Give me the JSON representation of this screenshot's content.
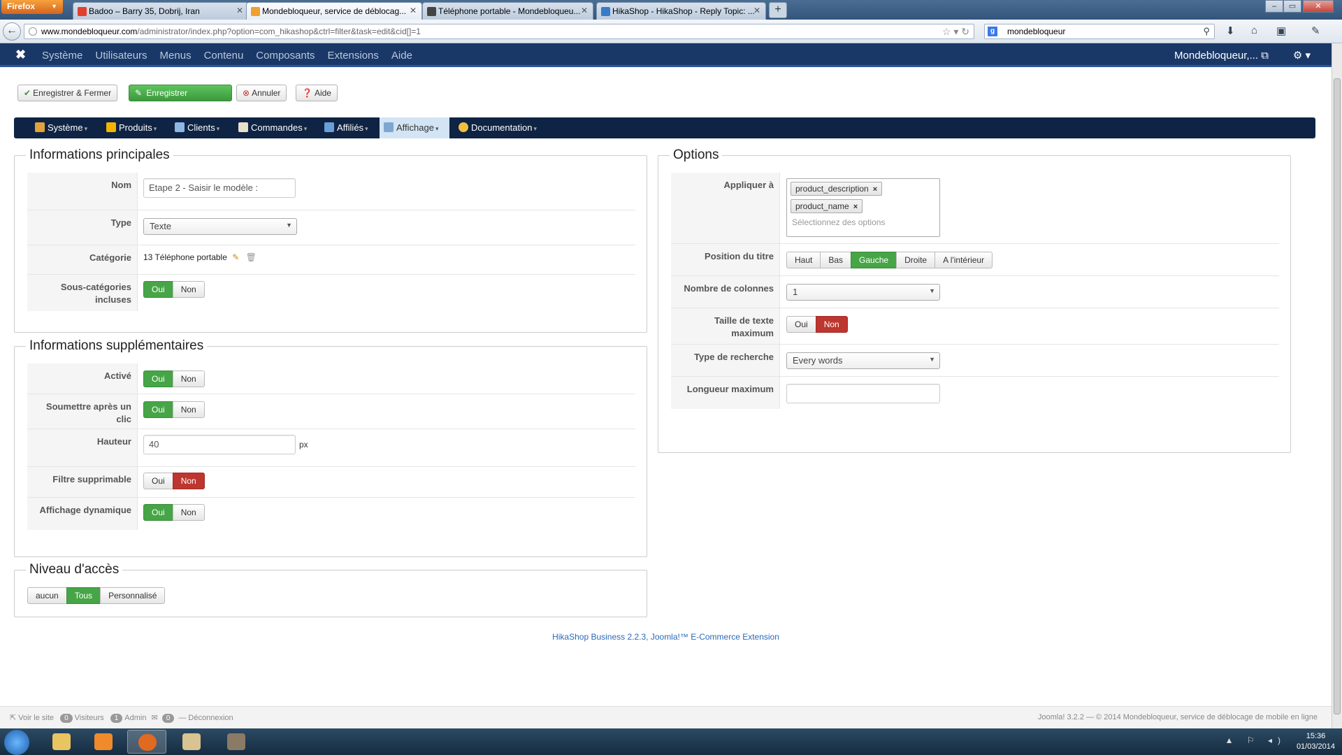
{
  "browser": {
    "app_button": "Firefox",
    "tabs": [
      {
        "title": "Badoo – Barry 35, Dobrij, Iran",
        "favicon_color": "#e0402c"
      },
      {
        "title": "Mondebloqueur, service de déblocag...",
        "favicon_color": "#f0a030"
      },
      {
        "title": "Téléphone portable - Mondebloqueu...",
        "favicon_color": "#444444"
      },
      {
        "title": "HikaShop - HikaShop - Reply Topic: ...",
        "favicon_color": "#3a7bc8"
      }
    ],
    "new_tab": "+",
    "url_host": "www.mondebloqueur.com",
    "url_path": "/administrator/index.php?option=com_hikashop&ctrl=filter&task=edit&cid[]=1",
    "search_value": "mondebloqueur"
  },
  "joomla": {
    "menu": [
      "Système",
      "Utilisateurs",
      "Menus",
      "Contenu",
      "Composants",
      "Extensions",
      "Aide"
    ],
    "user": "Mondebloqueur,..."
  },
  "toolbar": {
    "save_close": "Enregistrer & Fermer",
    "save": "Enregistrer",
    "cancel": "Annuler",
    "help": "Aide"
  },
  "hika_menu": {
    "items": [
      "Système",
      "Produits",
      "Clients",
      "Commandes",
      "Affiliés",
      "Affichage",
      "Documentation"
    ],
    "active": "Affichage"
  },
  "main_info": {
    "legend": "Informations principales",
    "name_label": "Nom",
    "name_value": "Etape 2 - Saisir le modèle :",
    "type_label": "Type",
    "type_value": "Texte",
    "category_label": "Catégorie",
    "category_value": "13 Téléphone portable",
    "subcat_label": "Sous-catégories incluses",
    "subcat_value": "Oui"
  },
  "extra_info": {
    "legend": "Informations supplémentaires",
    "active_label": "Activé",
    "active_value": "Oui",
    "submit_label": "Soumettre après un clic",
    "submit_value": "Oui",
    "height_label": "Hauteur",
    "height_value": "40",
    "height_unit": "px",
    "deletable_label": "Filtre supprimable",
    "deletable_value": "Non",
    "dynamic_label": "Affichage dynamique",
    "dynamic_value": "Oui"
  },
  "yes_no": {
    "yes": "Oui",
    "no": "Non"
  },
  "access": {
    "legend": "Niveau d'accès",
    "options": [
      "aucun",
      "Tous",
      "Personnalisé"
    ],
    "selected": "Tous"
  },
  "options": {
    "legend": "Options",
    "apply_label": "Appliquer à",
    "apply_tags": [
      "product_description",
      "product_name"
    ],
    "apply_placeholder": "Sélectionnez des options",
    "title_pos_label": "Position du titre",
    "title_pos_options": [
      "Haut",
      "Bas",
      "Gauche",
      "Droite",
      "A l'intérieur"
    ],
    "title_pos_selected": "Gauche",
    "columns_label": "Nombre de colonnes",
    "columns_value": "1",
    "max_text_label": "Taille de texte maximum",
    "max_text_value": "Non",
    "search_type_label": "Type de recherche",
    "search_type_value": "Every words",
    "max_length_label": "Longueur maximum",
    "max_length_value": ""
  },
  "footer": {
    "extension": "HikaShop Business 2.2.3, Joomla!™ E-Commerce Extension",
    "view_site": "Voir le site",
    "visitors_count": "0",
    "visitors": "Visiteurs",
    "admin_count": "1",
    "admin": "Admin",
    "messages_count": "0",
    "logout": "Déconnexion",
    "copyright": "Joomla! 3.2.2 — © 2014 Mondebloqueur, service de déblocage de mobile en ligne"
  },
  "taskbar": {
    "time": "15:36",
    "date": "01/03/2014"
  },
  "colors": {
    "joomla_bar": "#1a3867",
    "hika_menu": "#0f2444",
    "green": "#46a546",
    "red": "#bd362f"
  }
}
